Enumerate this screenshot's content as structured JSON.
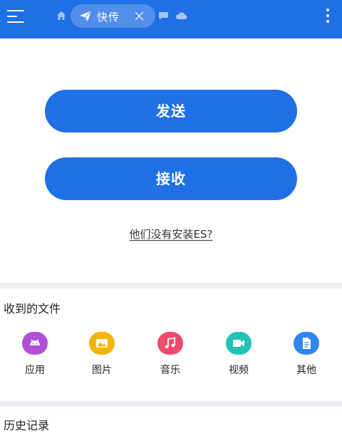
{
  "header": {
    "tab_label": "快传",
    "colors": {
      "bar": "#1f6fe5"
    },
    "icons": [
      "menu-icon",
      "home-icon",
      "send-icon",
      "close-icon",
      "chat-icon",
      "cloud-icon",
      "more-icon"
    ]
  },
  "main": {
    "send_label": "发送",
    "receive_label": "接收",
    "no_es_link": "他们没有安装ES?"
  },
  "received_files": {
    "title": "收到的文件",
    "categories": [
      {
        "label": "应用",
        "icon": "android-icon",
        "color": "#b14fd8"
      },
      {
        "label": "图片",
        "icon": "image-icon",
        "color": "#f4b400"
      },
      {
        "label": "音乐",
        "icon": "music-icon",
        "color": "#ef4b6c"
      },
      {
        "label": "视频",
        "icon": "video-icon",
        "color": "#22c3b0"
      },
      {
        "label": "其他",
        "icon": "document-icon",
        "color": "#2f86ee"
      }
    ]
  },
  "history": {
    "title": "历史记录"
  }
}
